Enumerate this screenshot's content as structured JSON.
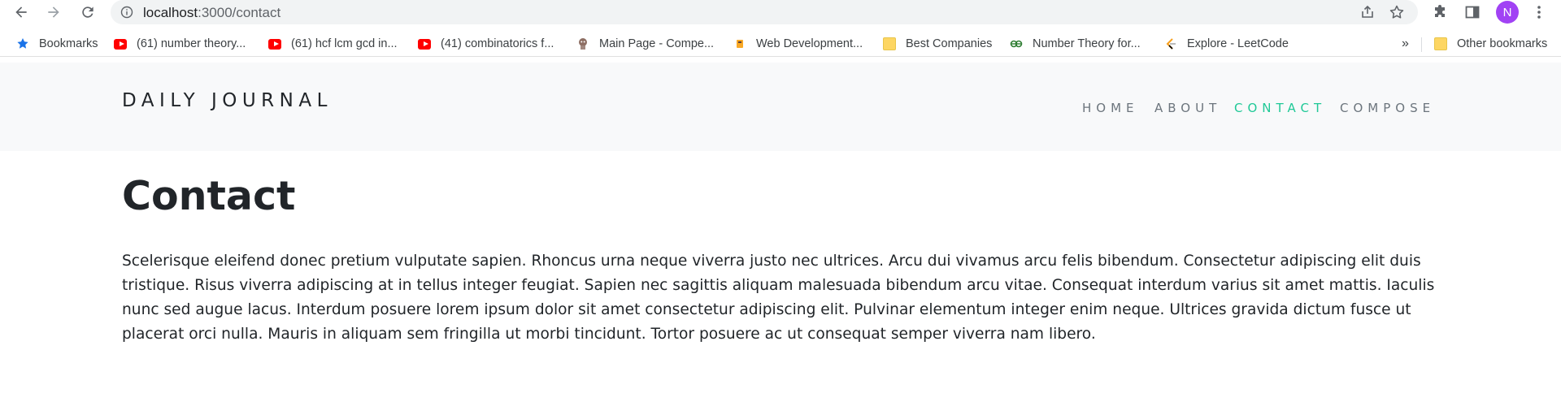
{
  "browser": {
    "url_host": "localhost",
    "url_path": ":3000/contact",
    "avatar_letter": "N",
    "bookmarks": [
      {
        "label": "Bookmarks",
        "icon": "star-icon"
      },
      {
        "label": "(61) number theory...",
        "icon": "youtube-icon"
      },
      {
        "label": "(61) hcf lcm gcd in...",
        "icon": "youtube-icon"
      },
      {
        "label": "(41) combinatorics f...",
        "icon": "youtube-icon"
      },
      {
        "label": "Main Page - Compe...",
        "icon": "site-logo-icon"
      },
      {
        "label": "Web Development...",
        "icon": "site-logo-icon"
      },
      {
        "label": "Best Companies",
        "icon": "folder-icon"
      },
      {
        "label": "Number Theory for...",
        "icon": "site-logo-icon"
      },
      {
        "label": "Explore - LeetCode",
        "icon": "leetcode-icon"
      }
    ],
    "more_bookmarks": "»",
    "other_bookmarks": "Other bookmarks"
  },
  "site": {
    "brand": "DAILY JOURNAL",
    "nav": [
      {
        "label": "HOME",
        "active": false
      },
      {
        "label": "ABOUT",
        "active": false
      },
      {
        "label": "CONTACT",
        "active": true
      },
      {
        "label": "COMPOSE",
        "active": false
      }
    ],
    "accent_color": "#20c997"
  },
  "content": {
    "title": "Contact",
    "body": "Scelerisque eleifend donec pretium vulputate sapien. Rhoncus urna neque viverra justo nec ultrices. Arcu dui vivamus arcu felis bibendum. Consectetur adipiscing elit duis tristique. Risus viverra adipiscing at in tellus integer feugiat. Sapien nec sagittis aliquam malesuada bibendum arcu vitae. Consequat interdum varius sit amet mattis. Iaculis nunc sed augue lacus. Interdum posuere lorem ipsum dolor sit amet consectetur adipiscing elit. Pulvinar elementum integer enim neque. Ultrices gravida dictum fusce ut placerat orci nulla. Mauris in aliquam sem fringilla ut morbi tincidunt. Tortor posuere ac ut consequat semper viverra nam libero."
  }
}
